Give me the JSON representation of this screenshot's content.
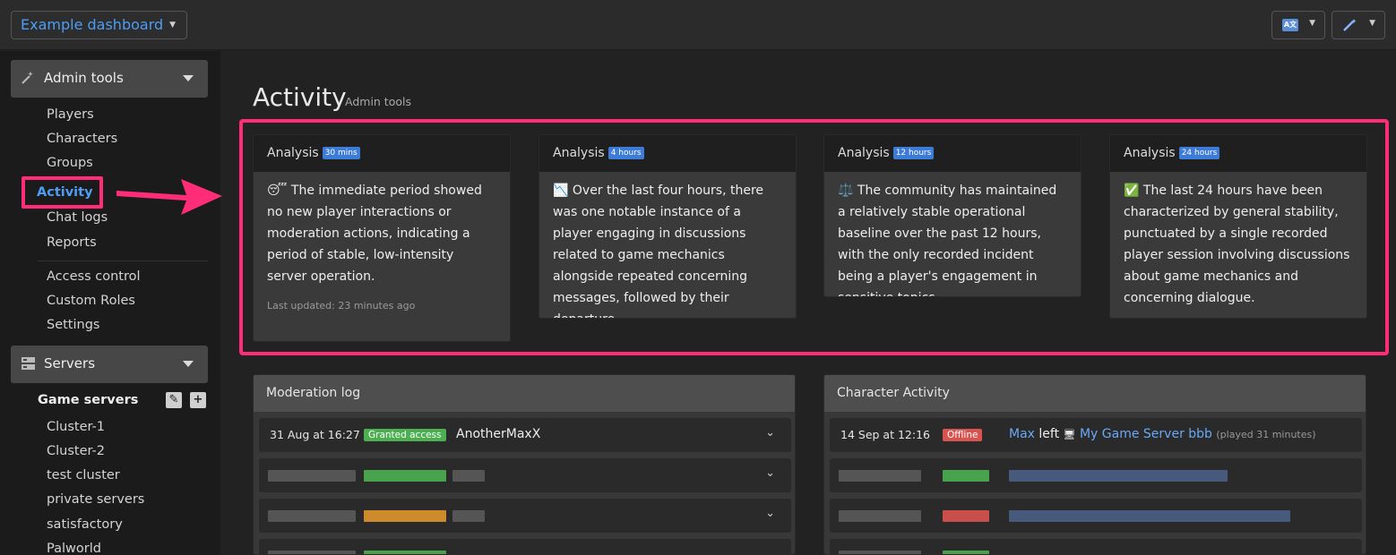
{
  "topbar": {
    "dashboard_select": "Example dashboard",
    "lang_icon": "translate-icon",
    "tools_icon": "magic-wand-icon"
  },
  "sidebar": {
    "admin_tools": {
      "label": "Admin tools",
      "items": [
        "Players",
        "Characters",
        "Groups",
        "Activity",
        "Chat logs",
        "Reports",
        "Access control",
        "Custom Roles",
        "Settings"
      ]
    },
    "servers": {
      "label": "Servers",
      "group_title": "Game servers",
      "items": [
        "Cluster-1",
        "Cluster-2",
        "test cluster",
        "private servers",
        "satisfactory",
        "Palworld"
      ]
    }
  },
  "page": {
    "title": "Activity",
    "subtitle": "Admin tools"
  },
  "analysis_cards": [
    {
      "label": "Analysis",
      "badge": "30 mins",
      "emoji": "😴",
      "text": "The immediate period showed no new player interactions or moderation actions, indicating a period of stable, low-intensity server operation.",
      "footer": "Last updated: 23 minutes ago"
    },
    {
      "label": "Analysis",
      "badge": "4 hours",
      "emoji": "📉",
      "text": "Over the last four hours, there was one notable instance of a player engaging in discussions related to game mechanics alongside repeated concerning messages, followed by their departure."
    },
    {
      "label": "Analysis",
      "badge": "12 hours",
      "emoji": "⚖️",
      "text": "The community has maintained a relatively stable operational baseline over the past 12 hours, with the only recorded incident being a player's engagement in sensitive topics."
    },
    {
      "label": "Analysis",
      "badge": "24 hours",
      "emoji": "✅",
      "text": "The last 24 hours have been characterized by general stability, punctuated by a single recorded player session involving discussions about game mechanics and concerning dialogue."
    }
  ],
  "moderation_log": {
    "title": "Moderation log",
    "first_row": {
      "date": "31 Aug at 16:27",
      "tag": "Granted access",
      "tag_color": "#4caf50",
      "name": "AnotherMaxX"
    },
    "blurred_tag_colors": [
      "#4caf50",
      "#e0962b",
      "#4caf50"
    ]
  },
  "character_activity": {
    "title": "Character Activity",
    "first_row": {
      "date": "14 Sep at 12:16",
      "tag": "Offline",
      "tag_color": "#d9534f",
      "player": "Max",
      "action": "left",
      "server_icon": "server-icon",
      "server": "My Game Server bbb",
      "duration": "(played 31 minutes)"
    },
    "blurred_tag_colors": [
      "#4caf50",
      "#d9534f",
      "#4caf50"
    ]
  },
  "colors": {
    "accent_blue": "#4d9df5",
    "highlight_pink": "#ff2d78"
  }
}
